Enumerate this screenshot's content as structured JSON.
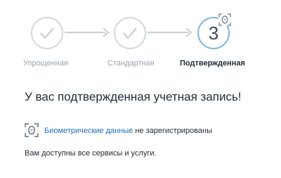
{
  "steps": [
    {
      "label": "Упрощенная",
      "state": "done"
    },
    {
      "label": "Стандартная",
      "state": "done"
    },
    {
      "label": "Подтвержденная",
      "state": "current",
      "number": "3"
    }
  ],
  "headline": "У вас подтвержденная учетная запись!",
  "biometrics": {
    "icon": "biometric-face-icon",
    "link_text": "Биометрические данные",
    "status_text": " не зарегистрированы"
  },
  "services_text": "Вам доступны все сервисы и услуги.",
  "colors": {
    "done_circle": "#d3d8dd",
    "current_circle": "#7fb6de",
    "link": "#1f6fb8",
    "text": "#1f2a35",
    "muted": "#98a2ac"
  }
}
